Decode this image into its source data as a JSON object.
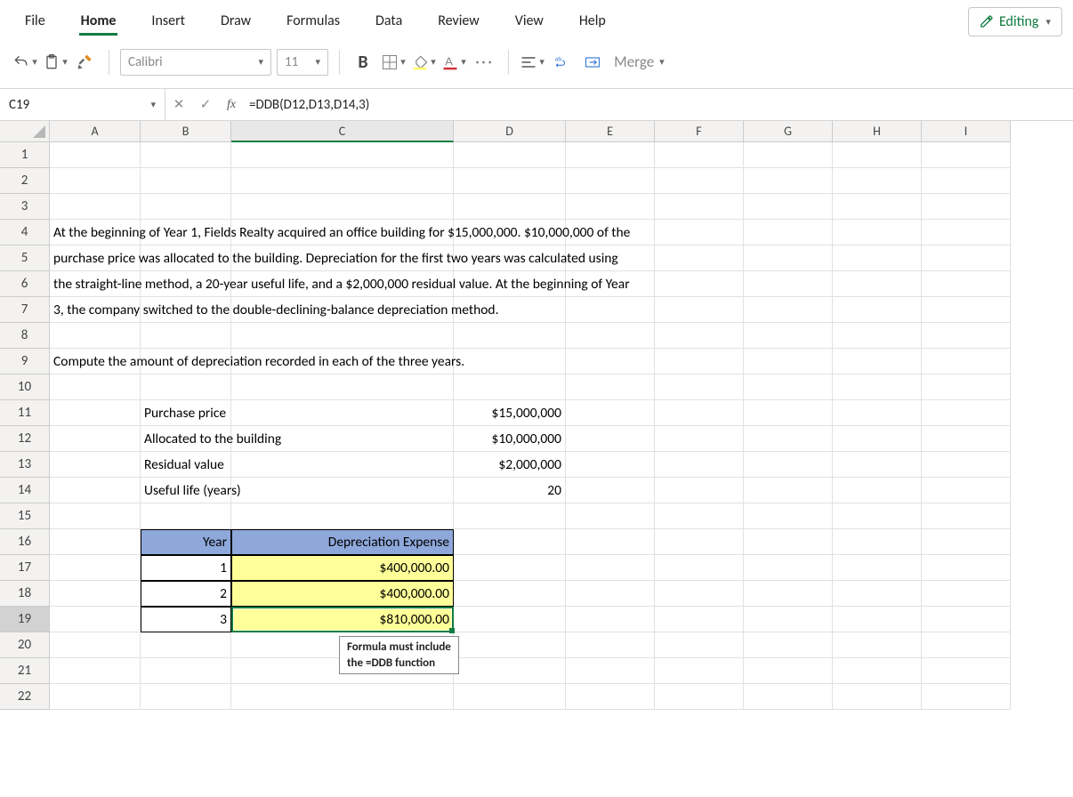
{
  "menu": {
    "file": "File",
    "home": "Home",
    "insert": "Insert",
    "draw": "Draw",
    "formulas": "Formulas",
    "data": "Data",
    "review": "Review",
    "view": "View",
    "help": "Help",
    "editing": "Editing"
  },
  "toolbar": {
    "font": "Calibri",
    "fontSize": "11",
    "merge": "Merge"
  },
  "nameBox": "C19",
  "formula": "=DDB(D12,D13,D14,3)",
  "columns": [
    "A",
    "B",
    "C",
    "D",
    "E",
    "F",
    "G",
    "H",
    "I"
  ],
  "rows": [
    "1",
    "2",
    "3",
    "4",
    "5",
    "6",
    "7",
    "8",
    "9",
    "10",
    "11",
    "12",
    "13",
    "14",
    "15",
    "16",
    "17",
    "18",
    "19",
    "20",
    "21",
    "22"
  ],
  "text": {
    "r4": "At the beginning of Year 1, Fields Realty acquired an office building for $15,000,000. $10,000,000 of the",
    "r5": "purchase price was allocated to the building. Depreciation for the first two years was calculated using",
    "r6": "the straight-line method, a 20-year useful life, and a $2,000,000 residual value. At the beginning of Year",
    "r7": "3, the company switched to the double-declining-balance depreciation method.",
    "r9": "Compute the amount of depreciation recorded in each of the three years.",
    "b11": "Purchase price",
    "d11": "$15,000,000",
    "b12": "Allocated to the building",
    "d12": "$10,000,000",
    "b13": "Residual value",
    "d13": "$2,000,000",
    "b14": "Useful life (years)",
    "d14": "20",
    "b16": "Year",
    "c16": "Depreciation Expense",
    "b17": "1",
    "c17": "$400,000.00",
    "b18": "2",
    "c18": "$400,000.00",
    "b19": "3",
    "c19": "$810,000.00"
  },
  "tooltip": {
    "l1": "Formula must include",
    "l2": "the =DDB function"
  },
  "chart_data": {
    "type": "table",
    "title": "Depreciation table",
    "inputs": {
      "purchase_price": 15000000,
      "allocated_to_building": 10000000,
      "residual_value": 2000000,
      "useful_life_years": 20
    },
    "columns": [
      "Year",
      "Depreciation Expense"
    ],
    "rows": [
      [
        1,
        400000.0
      ],
      [
        2,
        400000.0
      ],
      [
        3,
        810000.0
      ]
    ]
  }
}
